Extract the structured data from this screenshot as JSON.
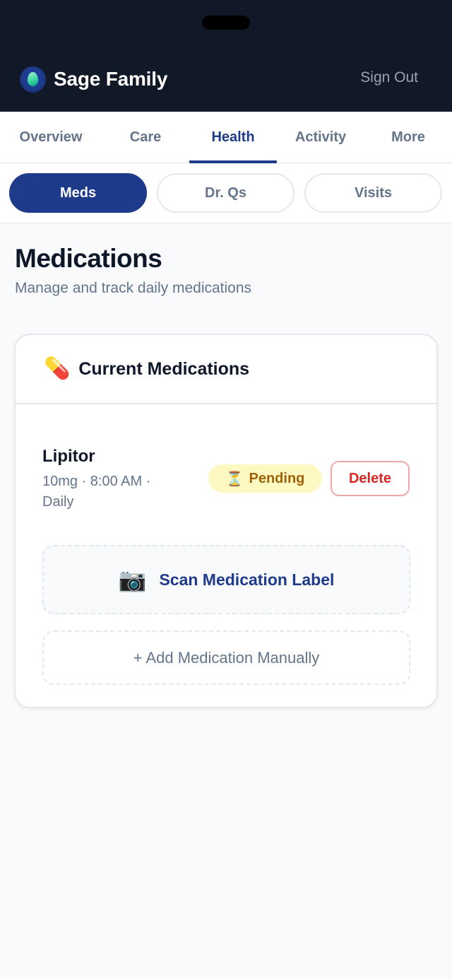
{
  "app": {
    "name": "Sage Family",
    "sign_out_label": "Sign Out"
  },
  "tabs": [
    {
      "label": "Overview",
      "active": false
    },
    {
      "label": "Care",
      "active": false
    },
    {
      "label": "Health",
      "active": true
    },
    {
      "label": "Activity",
      "active": false
    },
    {
      "label": "More",
      "active": false
    }
  ],
  "segments": [
    {
      "label": "Meds",
      "active": true
    },
    {
      "label": "Dr. Qs",
      "active": false
    },
    {
      "label": "Visits",
      "active": false
    }
  ],
  "page": {
    "title": "Medications",
    "subtitle": "Manage and track daily medications"
  },
  "card": {
    "icon": "💊",
    "title": "Current Medications",
    "medications": [
      {
        "name": "Lipitor",
        "detail": "10mg · 8:00 AM · Daily",
        "status_icon": "⏳",
        "status": "Pending",
        "delete_label": "Delete"
      }
    ],
    "scan_icon": "📷",
    "scan_label": "Scan Medication Label",
    "add_label": "+ Add Medication Manually"
  },
  "colors": {
    "header_bg": "#111827",
    "accent": "#1e3a8a",
    "pending_bg": "#fef9c3",
    "pending_text": "#a16207",
    "danger": "#dc2626"
  },
  "icons": {
    "logo": "droplet-logo-icon",
    "card": "pill-icon",
    "status": "hourglass-icon",
    "scan": "camera-icon"
  }
}
